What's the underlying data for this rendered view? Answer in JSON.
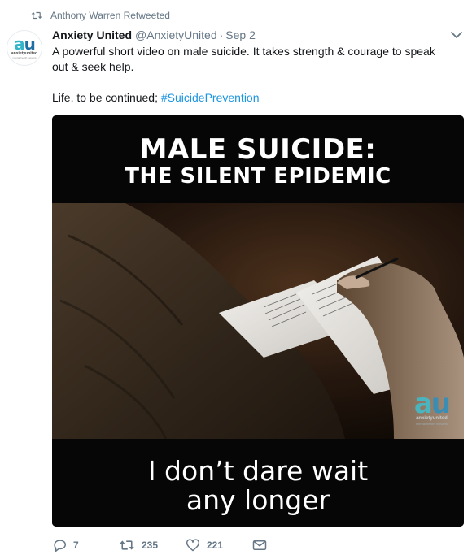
{
  "retweet_context": {
    "text": "Anthony Warren Retweeted",
    "icon": "retweet-icon"
  },
  "tweet": {
    "author": {
      "name": "Anxiety United",
      "handle": "@AnxietyUnited",
      "separator": "·",
      "date": "Sep 2",
      "avatar": {
        "mark_a": "a",
        "mark_u": "u",
        "brand": "anxietyunited",
        "tagline": "mental health network"
      }
    },
    "text_line1": "A powerful short video on male suicide. It takes strength & courage to speak out & seek help.",
    "text_line2_prefix": "Life, to be continued; ",
    "hashtag": "#SuicidePrevention",
    "media": {
      "title_line1": "MALE SUICIDE:",
      "title_line2": "THE SILENT EPIDEMIC",
      "caption_line1": "I don’t dare wait",
      "caption_line2": "any longer",
      "watermark": {
        "mark_a": "a",
        "mark_u": "u",
        "brand": "anxietyunited",
        "tagline": "mental health network"
      }
    },
    "actions": {
      "reply_count": "7",
      "retweet_count": "235",
      "like_count": "221"
    }
  },
  "colors": {
    "link": "#1b95e0",
    "meta": "#657786",
    "text": "#14171a",
    "brand_teal": "#35b6c8",
    "brand_blue": "#1d6fa3"
  }
}
